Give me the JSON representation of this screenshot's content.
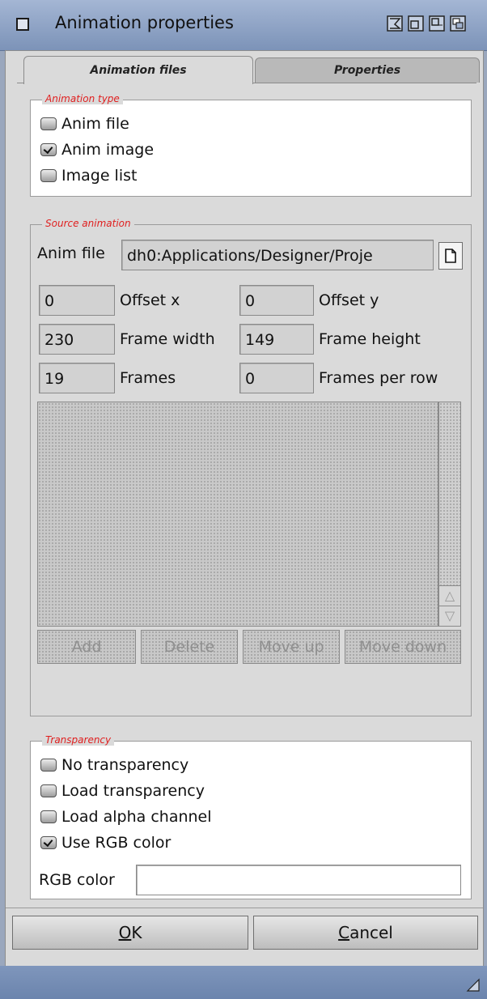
{
  "window": {
    "title": "Animation properties"
  },
  "tabs": [
    {
      "label": "Animation files"
    },
    {
      "label": "Properties"
    }
  ],
  "animation_type": {
    "title": "Animation type",
    "options": [
      {
        "label": "Anim file",
        "checked": false
      },
      {
        "label": "Anim image",
        "checked": true
      },
      {
        "label": "Image list",
        "checked": false
      }
    ]
  },
  "source_animation": {
    "title": "Source animation",
    "anim_file_label": "Anim file",
    "anim_file_value": "dh0:Applications/Designer/Proje",
    "offset_x": {
      "label": "Offset x",
      "value": "0"
    },
    "offset_y": {
      "label": "Offset y",
      "value": "0"
    },
    "frame_width": {
      "label": "Frame width",
      "value": "230"
    },
    "frame_height": {
      "label": "Frame height",
      "value": "149"
    },
    "frames": {
      "label": "Frames",
      "value": "19"
    },
    "frames_per_row": {
      "label": "Frames per row",
      "value": "0"
    },
    "buttons": {
      "add": "Add",
      "delete": "Delete",
      "move_up": "Move up",
      "move_down": "Move down"
    }
  },
  "transparency": {
    "title": "Transparency",
    "options": [
      {
        "label": "No transparency",
        "checked": false
      },
      {
        "label": "Load transparency",
        "checked": false
      },
      {
        "label": "Load alpha channel",
        "checked": false
      },
      {
        "label": "Use RGB color",
        "checked": true
      }
    ],
    "rgb_label": "RGB color",
    "rgb_value": ""
  },
  "footer": {
    "ok_rest": "K",
    "ok_key": "O",
    "cancel_rest": "ancel",
    "cancel_key": "C"
  },
  "colors": {
    "group_title": "#e02020",
    "titlebar": "#8ea3c6"
  }
}
